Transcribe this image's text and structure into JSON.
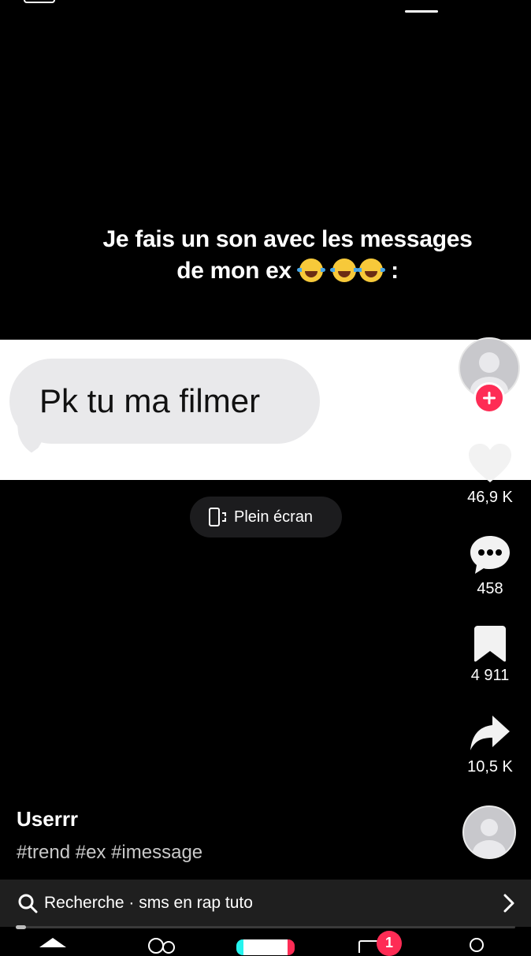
{
  "video": {
    "caption_line1": "Je fais un son avec les messages",
    "caption_line2": "de mon ex",
    "caption_suffix": ":",
    "caption_emojis": [
      "face-with-tears-of-joy",
      "face-with-tears-of-joy",
      "face-with-tears-of-joy"
    ],
    "message_text": "Pk tu ma filmer"
  },
  "fullscreen": {
    "label": "Plein écran",
    "icon": "fullscreen-icon"
  },
  "actions": {
    "likes": "46,9 K",
    "comments": "458",
    "bookmarks": "4 911",
    "shares": "10,5 K"
  },
  "post": {
    "username": "Userrr",
    "hashtags": "#trend #ex #imessage"
  },
  "search": {
    "label": "Recherche · sms en rap tuto"
  },
  "playback": {
    "progress": 0.02
  },
  "nav": {
    "inbox_badge": "1"
  },
  "colors": {
    "background": "#000000",
    "accent": "#fe2c55",
    "bubble": "#e9e9eb",
    "search_bar": "#1f1f1f"
  }
}
